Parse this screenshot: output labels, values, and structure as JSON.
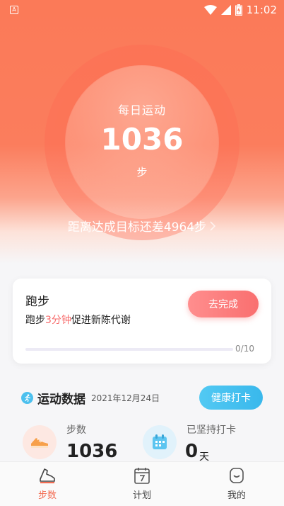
{
  "status_bar": {
    "app_badge": "A",
    "time": "11:02"
  },
  "hero": {
    "daily_label": "每日运动",
    "step_count": "1036",
    "step_unit": "步",
    "goal_text": "距离达成目标还差4964步"
  },
  "run_card": {
    "title": "跑步",
    "desc_prefix": "跑步",
    "desc_highlight": "3分钟",
    "desc_suffix": "促进新陈代谢",
    "button": "去完成",
    "progress_text": "0/10",
    "progress_fraction": 0
  },
  "exercise": {
    "title": "运动数据",
    "date": "2021年12月24日",
    "checkin_button": "健康打卡",
    "steps_label": "步数",
    "steps_value": "1036",
    "streak_label": "已坚持打卡",
    "streak_value": "0",
    "streak_unit": "天"
  },
  "nav": {
    "items": [
      {
        "label": "步数",
        "icon": "shoe-icon",
        "active": true
      },
      {
        "label": "计划",
        "icon": "calendar-icon",
        "active": false
      },
      {
        "label": "我的",
        "icon": "profile-icon",
        "active": false
      }
    ]
  },
  "colors": {
    "accent": "#f36c52",
    "highlight": "#f76a6a",
    "blue": "#42bdee"
  }
}
